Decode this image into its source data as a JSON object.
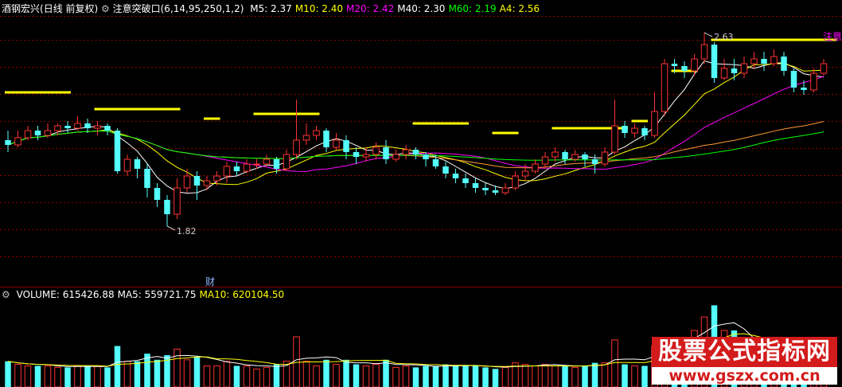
{
  "window": {
    "stock_name": "酒钢宏兴",
    "period": "(日线 前复权)",
    "indicator_name": "注意突破口(6,14,95,250,1,2)"
  },
  "price_panel": {
    "ma_readouts": [
      {
        "label": "M5:",
        "value": "2.37",
        "color": "#ffffff"
      },
      {
        "label": "M10:",
        "value": "2.40",
        "color": "#ffff00"
      },
      {
        "label": "M20:",
        "value": "2.42",
        "color": "#ff00ff"
      },
      {
        "label": "M40:",
        "value": "2.30",
        "color": "#ffffff"
      },
      {
        "label": "M60:",
        "value": "2.19",
        "color": "#00ff00"
      },
      {
        "label": "A4:",
        "value": "2.56",
        "color": "#ffff00"
      }
    ],
    "high_label": "2.63",
    "low_label": "1.82",
    "notice_tag": "注意",
    "cai_tag": "财"
  },
  "volume_panel": {
    "readouts": [
      {
        "label": "VOLUME:",
        "value": "615426.88",
        "color": "#ffffff"
      },
      {
        "label": "MA5:",
        "value": "559721.75",
        "color": "#ffffff"
      },
      {
        "label": "MA10:",
        "value": "620104.50",
        "color": "#ffff00"
      }
    ]
  },
  "watermark": {
    "title": "股票公式指标网",
    "url": "www.gszx.com.cn"
  },
  "colors": {
    "up": "#ff3232",
    "down": "#54fcfc",
    "ma5": "#ffffff",
    "ma10": "#ffff00",
    "ma20": "#ff00ff",
    "ma60": "#00ff00",
    "ma120": "#ff9933",
    "grid": "#8b0000",
    "signal": "#ffff00"
  },
  "chart_data": {
    "type": "candlestick",
    "ylim": [
      1.6,
      2.7
    ],
    "candles": [
      [
        2.18,
        2.16,
        2.22,
        2.13
      ],
      [
        2.16,
        2.19,
        2.22,
        2.15
      ],
      [
        2.19,
        2.22,
        2.24,
        2.18
      ],
      [
        2.22,
        2.2,
        2.24,
        2.18
      ],
      [
        2.2,
        2.22,
        2.25,
        2.19
      ],
      [
        2.22,
        2.24,
        2.25,
        2.2
      ],
      [
        2.24,
        2.23,
        2.26,
        2.21
      ],
      [
        2.23,
        2.25,
        2.28,
        2.22
      ],
      [
        2.25,
        2.23,
        2.27,
        2.21
      ],
      [
        2.23,
        2.24,
        2.26,
        2.2
      ],
      [
        2.24,
        2.22,
        2.25,
        2.2
      ],
      [
        2.22,
        2.05,
        2.23,
        2.04
      ],
      [
        2.05,
        2.1,
        2.12,
        2.03
      ],
      [
        2.1,
        2.06,
        2.11,
        2.02
      ],
      [
        2.06,
        1.98,
        2.08,
        1.94
      ],
      [
        1.98,
        1.93,
        2.0,
        1.9
      ],
      [
        1.93,
        1.87,
        1.95,
        1.82
      ],
      [
        1.87,
        1.98,
        2.02,
        1.85
      ],
      [
        1.98,
        2.03,
        2.06,
        1.96
      ],
      [
        2.03,
        1.99,
        2.05,
        1.93
      ],
      [
        1.99,
        2.01,
        2.03,
        1.97
      ],
      [
        2.01,
        2.03,
        2.05,
        1.99
      ],
      [
        2.03,
        2.07,
        2.09,
        2.0
      ],
      [
        2.07,
        2.05,
        2.09,
        2.03
      ],
      [
        2.05,
        2.08,
        2.1,
        2.04
      ],
      [
        2.08,
        2.08,
        2.1,
        2.06
      ],
      [
        2.08,
        2.1,
        2.12,
        2.07
      ],
      [
        2.1,
        2.06,
        2.11,
        2.04
      ],
      [
        2.06,
        2.12,
        2.14,
        2.05
      ],
      [
        2.12,
        2.18,
        2.35,
        2.1
      ],
      [
        2.18,
        2.2,
        2.25,
        2.16
      ],
      [
        2.2,
        2.22,
        2.24,
        2.18
      ],
      [
        2.22,
        2.15,
        2.23,
        2.13
      ],
      [
        2.15,
        2.18,
        2.21,
        2.14
      ],
      [
        2.18,
        2.13,
        2.2,
        2.1
      ],
      [
        2.13,
        2.11,
        2.15,
        2.08
      ],
      [
        2.11,
        2.12,
        2.15,
        2.09
      ],
      [
        2.12,
        2.15,
        2.17,
        2.1
      ],
      [
        2.15,
        2.1,
        2.18,
        2.08
      ],
      [
        2.1,
        2.12,
        2.14,
        2.09
      ],
      [
        2.12,
        2.14,
        2.16,
        2.1
      ],
      [
        2.14,
        2.12,
        2.15,
        2.1
      ],
      [
        2.12,
        2.1,
        2.13,
        2.07
      ],
      [
        2.1,
        2.07,
        2.12,
        2.06
      ],
      [
        2.07,
        2.04,
        2.09,
        2.02
      ],
      [
        2.04,
        2.02,
        2.06,
        2.0
      ],
      [
        2.02,
        2.0,
        2.04,
        1.98
      ],
      [
        2.0,
        1.98,
        2.02,
        1.96
      ],
      [
        1.98,
        1.97,
        2.0,
        1.95
      ],
      [
        1.97,
        1.96,
        1.99,
        1.95
      ],
      [
        1.96,
        1.98,
        2.0,
        1.95
      ],
      [
        1.98,
        2.03,
        2.05,
        1.97
      ],
      [
        2.03,
        2.05,
        2.08,
        2.01
      ],
      [
        2.05,
        2.08,
        2.1,
        2.04
      ],
      [
        2.08,
        2.11,
        2.13,
        2.06
      ],
      [
        2.11,
        2.13,
        2.15,
        2.09
      ],
      [
        2.13,
        2.1,
        2.14,
        2.08
      ],
      [
        2.1,
        2.12,
        2.14,
        2.09
      ],
      [
        2.12,
        2.1,
        2.13,
        2.07
      ],
      [
        2.1,
        2.08,
        2.12,
        2.04
      ],
      [
        2.08,
        2.13,
        2.15,
        2.07
      ],
      [
        2.13,
        2.24,
        2.35,
        2.12
      ],
      [
        2.24,
        2.21,
        2.26,
        2.19
      ],
      [
        2.21,
        2.23,
        2.25,
        2.19
      ],
      [
        2.23,
        2.2,
        2.24,
        2.18
      ],
      [
        2.2,
        2.3,
        2.38,
        2.19
      ],
      [
        2.3,
        2.5,
        2.52,
        2.28
      ],
      [
        2.5,
        2.49,
        2.52,
        2.46
      ],
      [
        2.49,
        2.47,
        2.51,
        2.44
      ],
      [
        2.47,
        2.52,
        2.54,
        2.45
      ],
      [
        2.52,
        2.58,
        2.63,
        2.5
      ],
      [
        2.58,
        2.44,
        2.59,
        2.42
      ],
      [
        2.44,
        2.48,
        2.52,
        2.43
      ],
      [
        2.48,
        2.46,
        2.52,
        2.43
      ],
      [
        2.46,
        2.5,
        2.53,
        2.44
      ],
      [
        2.5,
        2.52,
        2.55,
        2.48
      ],
      [
        2.52,
        2.5,
        2.55,
        2.47
      ],
      [
        2.5,
        2.53,
        2.56,
        2.49
      ],
      [
        2.53,
        2.47,
        2.55,
        2.45
      ],
      [
        2.47,
        2.4,
        2.48,
        2.38
      ],
      [
        2.4,
        2.39,
        2.43,
        2.37
      ],
      [
        2.39,
        2.46,
        2.48,
        2.38
      ],
      [
        2.46,
        2.5,
        2.52,
        2.45
      ]
    ],
    "volume_ylim": [
      0,
      1800000
    ]
  }
}
